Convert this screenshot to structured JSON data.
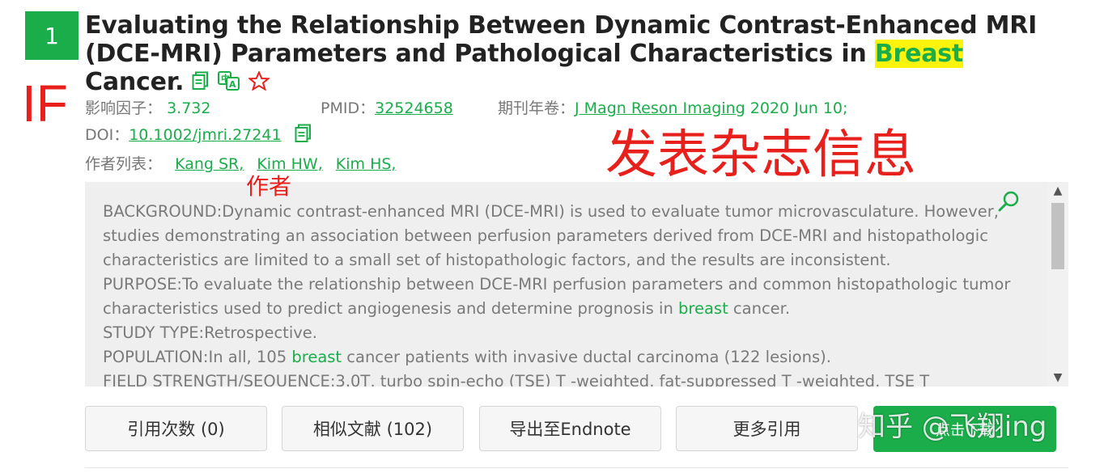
{
  "article": {
    "index": "1",
    "title_before": "Evaluating the Relationship Between Dynamic Contrast-Enhanced MRI (DCE-MRI) Parameters and Pathological Characteristics in ",
    "title_highlight": "Breast",
    "title_after": " Cancer.",
    "impact_factor_label": "影响因子：",
    "impact_factor_value": "3.732",
    "pmid_label": "PMID：",
    "pmid_value": "32524658",
    "journal_label": "期刊年卷：",
    "journal_value": "J Magn Reson Imaging",
    "journal_date": " 2020 Jun 10;",
    "doi_label": "DOI：",
    "doi_value": "10.1002/jmri.27241",
    "authors_label": "作者列表：",
    "authors": [
      "Kang SR,",
      "Kim HW,",
      "Kim HS,"
    ]
  },
  "annotations": {
    "if": "IF",
    "journal_info": "发表杂志信息",
    "author": "作者"
  },
  "abstract": {
    "p1": "BACKGROUND:Dynamic contrast-enhanced MRI (DCE-MRI) is used to evaluate tumor microvasculature. However, studies demonstrating an association between perfusion parameters derived from DCE-MRI and histopathologic characteristics are limited to a small set of histopathologic factors, and the results are inconsistent.",
    "p2_before": "PURPOSE:To evaluate the relationship between DCE-MRI perfusion parameters and common histopathologic tumor characteristics used to predict angiogenesis and determine prognosis in ",
    "p2_kw": "breast",
    "p2_after": " cancer.",
    "p3": "STUDY TYPE:Retrospective.",
    "p4_before": "POPULATION:In all, 105 ",
    "p4_kw": "breast",
    "p4_after": " cancer patients with invasive ductal carcinoma (122 lesions).",
    "p5": "FIELD STRENGTH/SEQUENCE:3.0T, turbo spin-echo (TSE) T -weighted, fat-suppressed T -weighted, TSE T"
  },
  "buttons": {
    "cite": "引用次数 (0)",
    "similar": "相似文献 (102)",
    "endnote": "导出至Endnote",
    "more": "更多引用",
    "download": "点击下载"
  },
  "watermark": "知乎 @飞翔ing",
  "colors": {
    "accent": "#1aad4a",
    "annotation": "#e8201c",
    "highlight": "#fdf30b"
  }
}
